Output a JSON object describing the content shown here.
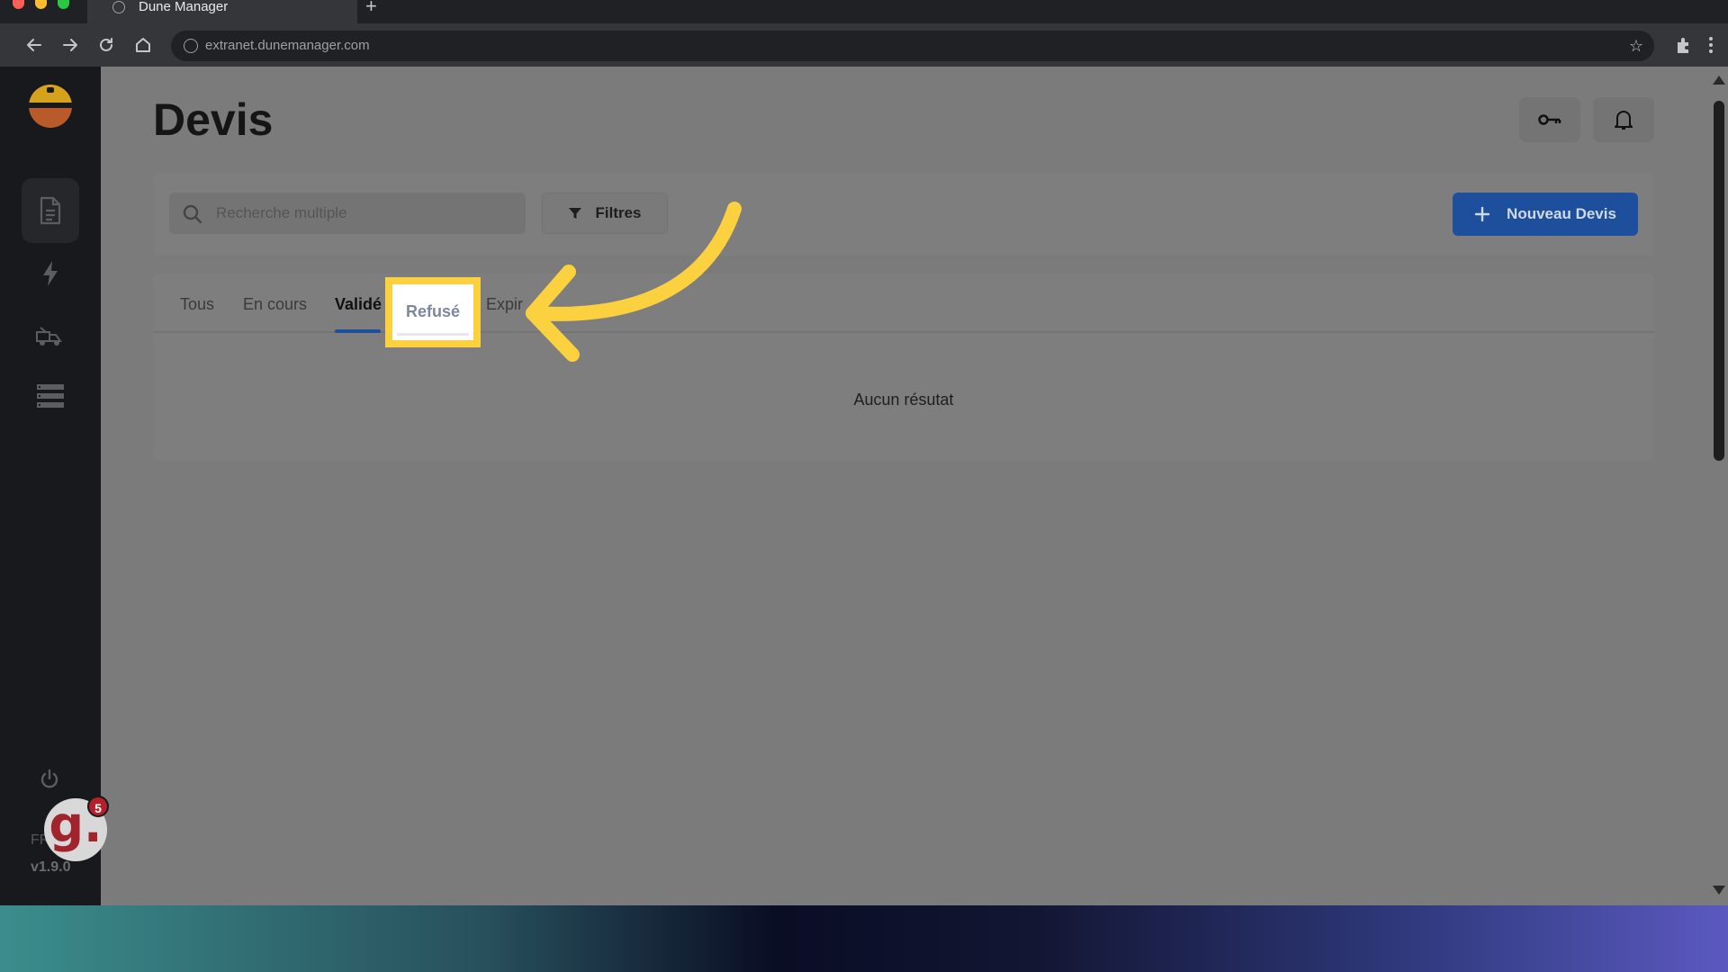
{
  "browser": {
    "tab_title": "Dune Manager",
    "url": "extranet.dunemanager.com"
  },
  "page": {
    "title": "Devis"
  },
  "search": {
    "placeholder": "Recherche multiple"
  },
  "actions": {
    "filters_label": "Filtres",
    "new_label": "Nouveau Devis"
  },
  "tabs": [
    {
      "label": "Tous"
    },
    {
      "label": "En cours"
    },
    {
      "label": "Validé"
    },
    {
      "label": "Refusé"
    },
    {
      "label": "Expir"
    }
  ],
  "selected_tab": "Validé",
  "highlighted_tab": "Refusé",
  "list": {
    "empty_message": "Aucun résutat"
  },
  "sidebar": {
    "items": [
      {
        "icon": "document-icon",
        "active": true
      },
      {
        "icon": "lightning-icon"
      },
      {
        "icon": "truck-icon"
      },
      {
        "icon": "list-icon"
      }
    ],
    "lang_label": "FR",
    "version": "v1.9.0",
    "notification_count": "5",
    "avatar_letter": "g."
  },
  "colors": {
    "accent": "#1d4f9c",
    "highlight": "#fbd13f",
    "sidebar": "#18191c"
  }
}
